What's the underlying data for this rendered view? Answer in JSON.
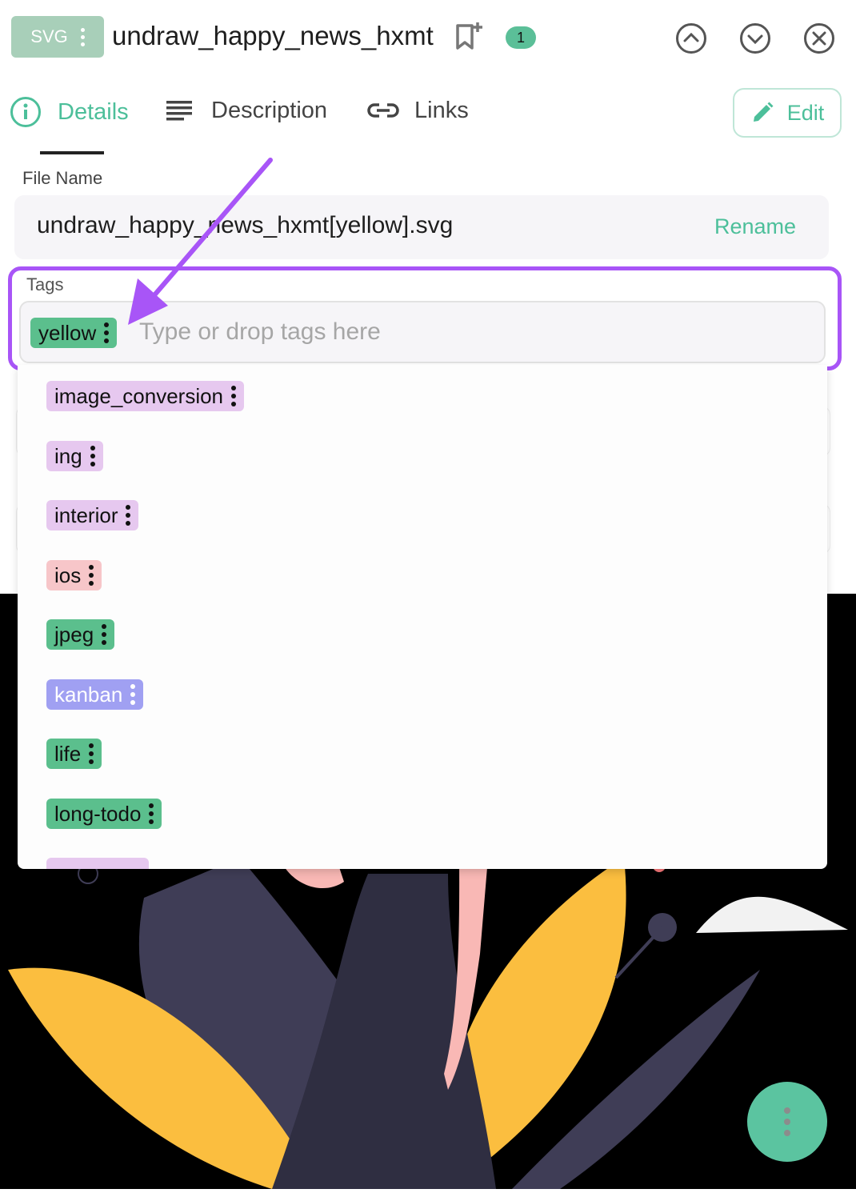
{
  "header": {
    "file_type": "SVG",
    "title": "undraw_happy_news_hxmt",
    "count": "1"
  },
  "tabs": [
    {
      "label": "Details"
    },
    {
      "label": "Description"
    },
    {
      "label": "Links"
    }
  ],
  "edit_label": "Edit",
  "file": {
    "label": "File Name",
    "value": "undraw_happy_news_hxmt[yellow].svg",
    "rename_label": "Rename"
  },
  "tags": {
    "label": "Tags",
    "placeholder": "Type or drop tags here",
    "selected": [
      {
        "label": "yellow",
        "color": "#5bbf8d"
      }
    ]
  },
  "suggestions": [
    {
      "label": "image_conversion",
      "color": "#e6c8ef"
    },
    {
      "label": "ing",
      "color": "#e6c8ef"
    },
    {
      "label": "interior",
      "color": "#e6c8ef"
    },
    {
      "label": "ios",
      "color": "#f7c6c9"
    },
    {
      "label": "jpeg",
      "color": "#5bbf8d"
    },
    {
      "label": "kanban",
      "color": "#a0a0f2"
    },
    {
      "label": "life",
      "color": "#5bbf8d"
    },
    {
      "label": "long-todo",
      "color": "#5bbf8d"
    }
  ],
  "colors": {
    "accent": "#4cbf9a",
    "highlight": "#a855f7"
  },
  "icons": {
    "bookmark": "bookmark-add-icon",
    "up": "chevron-up-circle-icon",
    "down": "chevron-down-circle-icon",
    "close": "close-circle-icon",
    "details": "info-icon",
    "description": "lines-icon",
    "links": "link-icon",
    "edit": "pencil-icon",
    "menu": "kebab-menu-icon"
  }
}
